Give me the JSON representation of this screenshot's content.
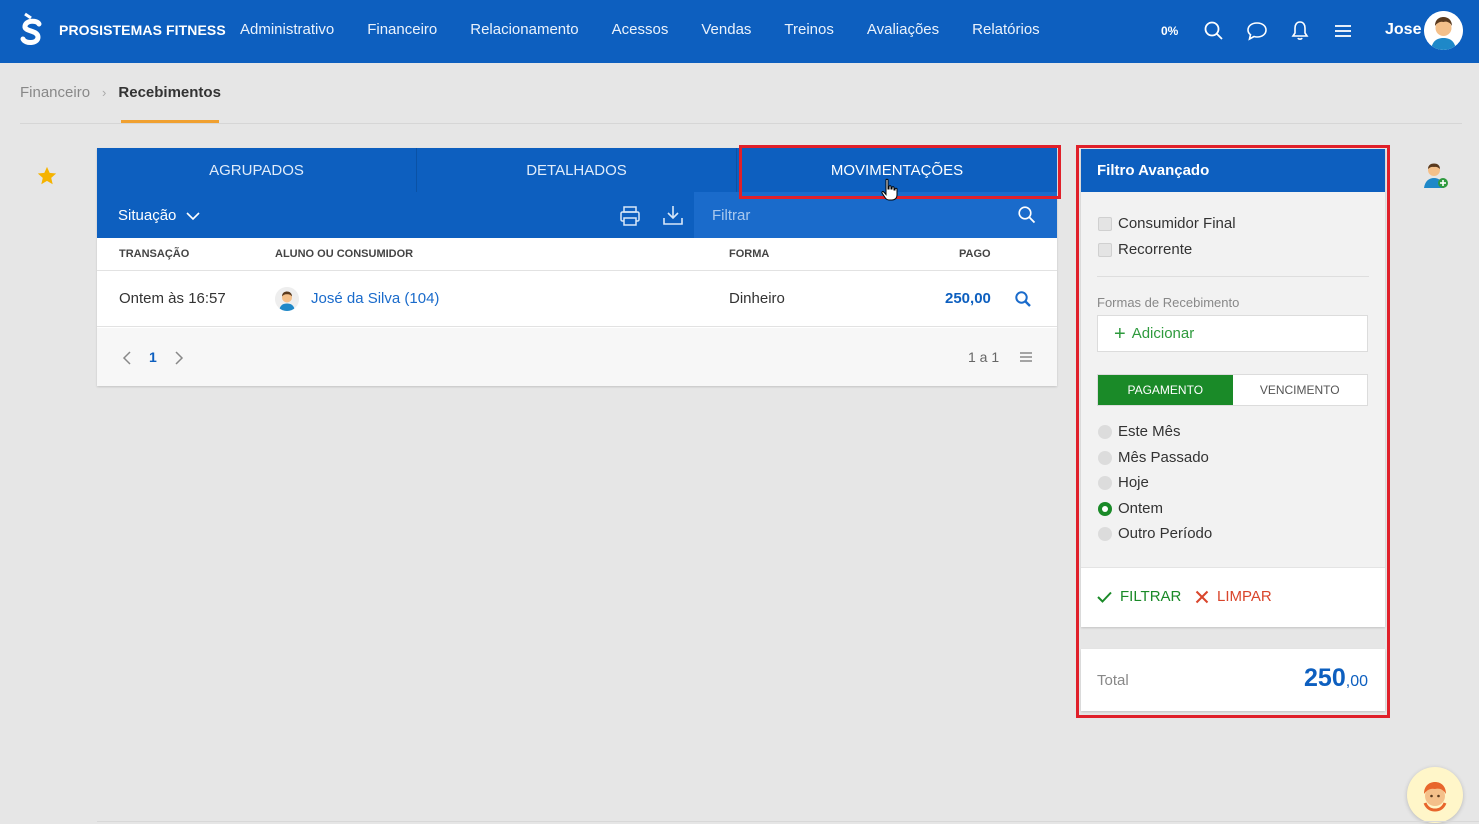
{
  "app": {
    "brand": "PROSISTEMAS FITNESS",
    "nav": [
      "Administrativo",
      "Financeiro",
      "Relacionamento",
      "Acessos",
      "Vendas",
      "Treinos",
      "Avaliações",
      "Relatórios"
    ],
    "progress": "0%",
    "user": "Jose"
  },
  "breadcrumb": {
    "parent": "Financeiro",
    "current": "Recebimentos"
  },
  "tabs": [
    {
      "label": "AGRUPADOS"
    },
    {
      "label": "DETALHADOS"
    },
    {
      "label": "MOVIMENTAÇÕES",
      "active": true
    }
  ],
  "toolbar": {
    "situacao": "Situação",
    "search_placeholder": "Filtrar"
  },
  "table": {
    "headers": {
      "transacao": "TRANSAÇÃO",
      "aluno": "ALUNO OU CONSUMIDOR",
      "forma": "FORMA",
      "pago": "PAGO"
    },
    "rows": [
      {
        "transacao": "Ontem às 16:57",
        "aluno": "José da Silva (104)",
        "forma": "Dinheiro",
        "pago": "250,00"
      }
    ],
    "pagination": {
      "page": "1",
      "info": "1 a 1"
    }
  },
  "filter": {
    "title": "Filtro Avançado",
    "checkboxes": [
      "Consumidor Final",
      "Recorrente"
    ],
    "formas_label": "Formas de Recebimento",
    "add_label": "Adicionar",
    "segment": {
      "on": "PAGAMENTO",
      "off": "VENCIMENTO"
    },
    "periods": [
      "Este Mês",
      "Mês Passado",
      "Hoje",
      "Ontem",
      "Outro Período"
    ],
    "selected_period": "Ontem",
    "filtrar": "FILTRAR",
    "limpar": "LIMPAR"
  },
  "total": {
    "label": "Total",
    "value": "250",
    "cents": ",00"
  },
  "colors": {
    "primary": "#0d5fbf",
    "green": "#1a8a28",
    "red": "#d9452b",
    "highlight": "#e0202a"
  }
}
